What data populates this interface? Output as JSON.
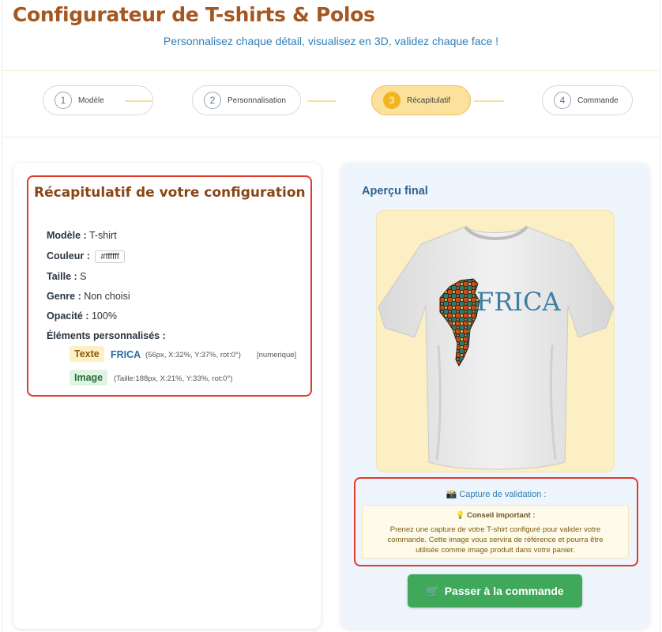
{
  "header": {
    "title": "Configurateur de T-shirts & Polos",
    "subtitle": "Personnalisez chaque détail, visualisez en 3D, validez chaque face !"
  },
  "steps": [
    {
      "num": "1",
      "label": "Modèle",
      "active": false
    },
    {
      "num": "2",
      "label": "Personnalisation",
      "active": false
    },
    {
      "num": "3",
      "label": "Récapitulatif",
      "active": true
    },
    {
      "num": "4",
      "label": "Commande",
      "active": false
    }
  ],
  "summary": {
    "title": "Récapitulatif de votre configuration",
    "model_label": "Modèle :",
    "model_value": "T-shirt",
    "color_label": "Couleur :",
    "color_value": "#ffffff",
    "size_label": "Taille :",
    "size_value": "S",
    "gender_label": "Genre :",
    "gender_value": "Non choisi",
    "opacity_label": "Opacité :",
    "opacity_value": "100%",
    "elements_label": "Éléments personnalisés :",
    "text_badge": "Texte",
    "text_value": "FRICA",
    "text_details": "(56px, X:32%, Y:37%, rot:0°)",
    "text_font": "[numerique]",
    "image_badge": "Image",
    "image_details": "(Taille:188px, X:21%, Y:33%, rot:0°)"
  },
  "preview": {
    "title": "Aperçu final",
    "shirt_text": "FRICA",
    "capture_icon": "camera-icon",
    "capture_label": "Capture de validation :",
    "tip_icon": "lightbulb-icon",
    "tip_title": "Conseil important :",
    "tip_body": "Prenez une capture de votre T-shirt configuré pour valider votre commande. Cette image vous servira de référence et pourra être utilisée comme image produit dans votre panier.",
    "order_icon": "cart-icon",
    "order_button": "Passer à la commande"
  },
  "colors": {
    "title": "#a6561f",
    "accent_blue": "#2f7fb8",
    "active_step": "#fbe19b",
    "button_green": "#3fa85a",
    "highlight_red": "#de3b2c"
  }
}
